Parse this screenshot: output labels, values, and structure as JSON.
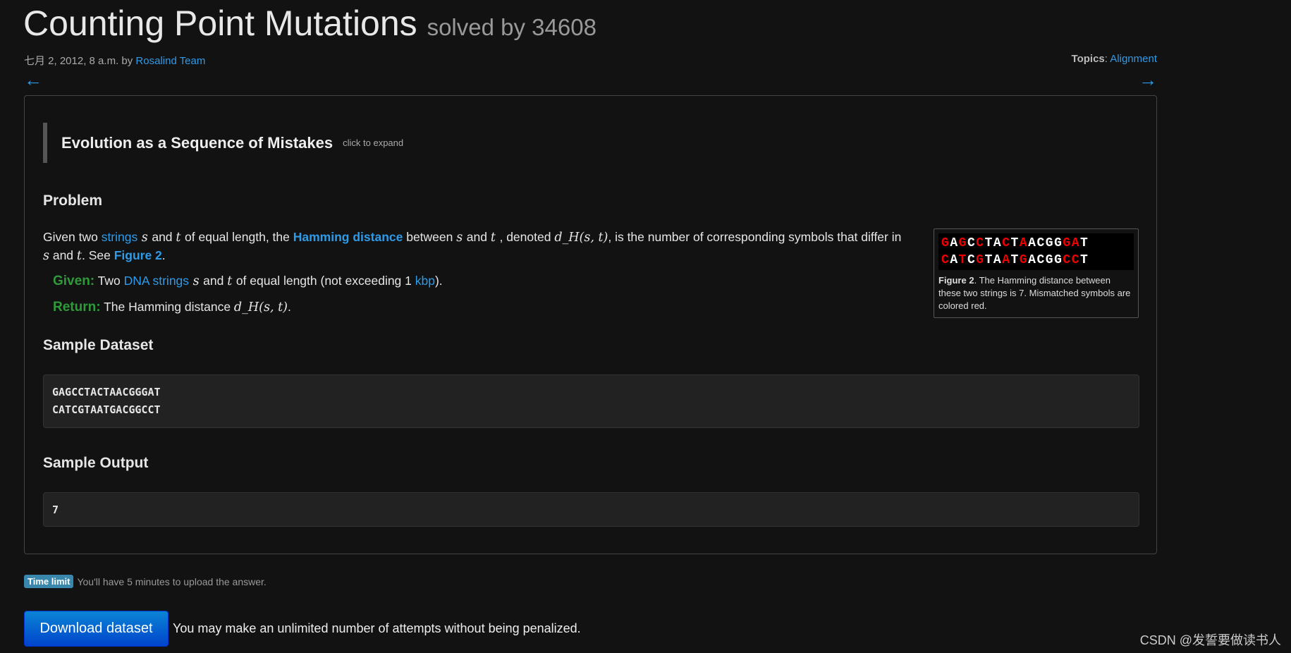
{
  "header": {
    "title": "Counting Point Mutations",
    "solved": "solved by 34608",
    "date": "七月 2, 2012, 8 a.m. by ",
    "author": "Rosalind Team",
    "topics_label": "Topics",
    "topics_sep": ": ",
    "topic": "Alignment",
    "prev": "←",
    "next": "→"
  },
  "blockquote": {
    "title": "Evolution as a Sequence of Mistakes",
    "expand": "click to expand"
  },
  "problem": {
    "heading": "Problem",
    "p1": [
      "Given two ",
      "strings",
      " s ",
      " and ",
      " t ",
      " of equal length, the ",
      "Hamming distance",
      " between ",
      " s ",
      " and ",
      " t ",
      ", denoted ",
      "d_H(s, t)",
      ", is the number of corresponding symbols that differ in"
    ],
    "p2": [
      "s",
      " and ",
      "t",
      ". See ",
      "Figure 2",
      "."
    ],
    "given_label": "Given:",
    "given": [
      "Two ",
      "DNA strings",
      " s ",
      " and ",
      " t ",
      " of equal length (not exceeding 1 ",
      "kbp",
      "). "
    ],
    "return_label": "Return:",
    "return": [
      "The Hamming distance ",
      "d_H(s, t)",
      "."
    ]
  },
  "figure": {
    "row1": [
      [
        "G",
        1
      ],
      [
        "A",
        0
      ],
      [
        "G",
        1
      ],
      [
        "C",
        0
      ],
      [
        "C",
        1
      ],
      [
        "T",
        0
      ],
      [
        "A",
        0
      ],
      [
        "C",
        1
      ],
      [
        "T",
        0
      ],
      [
        "A",
        1
      ],
      [
        "A",
        0
      ],
      [
        "C",
        0
      ],
      [
        "G",
        0
      ],
      [
        "G",
        0
      ],
      [
        "G",
        1
      ],
      [
        "A",
        1
      ],
      [
        "T",
        0
      ]
    ],
    "row2": [
      [
        "C",
        1
      ],
      [
        "A",
        0
      ],
      [
        "T",
        1
      ],
      [
        "C",
        0
      ],
      [
        "G",
        1
      ],
      [
        "T",
        0
      ],
      [
        "A",
        0
      ],
      [
        "A",
        1
      ],
      [
        "T",
        0
      ],
      [
        "G",
        1
      ],
      [
        "A",
        0
      ],
      [
        "C",
        0
      ],
      [
        "G",
        0
      ],
      [
        "G",
        0
      ],
      [
        "C",
        1
      ],
      [
        "C",
        1
      ],
      [
        "T",
        0
      ]
    ],
    "caption_bold": "Figure 2",
    "caption": ". The Hamming distance between these two strings is 7. Mismatched symbols are colored red.",
    "mismatch_color": "#ee0000"
  },
  "sample_dataset": {
    "heading": "Sample Dataset",
    "lines": [
      "GAGCCTACTAACGGGAT",
      "CATCGTAATGACGGCCT"
    ]
  },
  "sample_output": {
    "heading": "Sample Output",
    "value": "7"
  },
  "time_limit": {
    "badge": "Time limit",
    "text": "You'll have 5 minutes to upload the answer."
  },
  "download": {
    "button": "Download dataset",
    "note": "You may make an unlimited number of attempts without being penalized."
  },
  "watermark": "CSDN @发誓要做读书人"
}
